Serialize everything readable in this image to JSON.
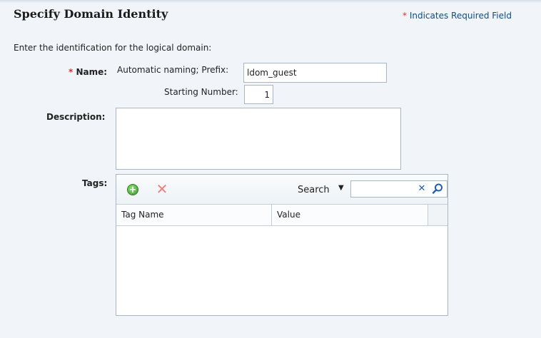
{
  "page": {
    "title": "Specify Domain Identity",
    "required_marker": "*",
    "required_note": "Indicates Required Field",
    "intro": "Enter the identification for the logical domain:"
  },
  "form": {
    "name_label": "Name:",
    "naming_label": "Automatic naming; Prefix:",
    "prefix_value": "ldom_guest",
    "starting_number_label": "Starting Number:",
    "starting_number_value": "1",
    "description_label": "Description:",
    "description_value": "",
    "tags_label": "Tags:"
  },
  "tags": {
    "toolbar": {
      "add_icon": "add-circle-icon",
      "delete_icon": "delete-x-icon",
      "search_label": "Search",
      "search_value": "",
      "clear_icon": "clear-x-icon",
      "search_icon": "magnifier-icon"
    },
    "columns": [
      "Tag Name",
      "Value"
    ],
    "rows": []
  },
  "colors": {
    "background": "#f1f5f9",
    "required_star": "#d0342c",
    "required_note_text": "#0b4d8a",
    "border": "#a9b6c3",
    "add_green": "#3f9a2e",
    "delete_red": "#ef7f7f"
  }
}
